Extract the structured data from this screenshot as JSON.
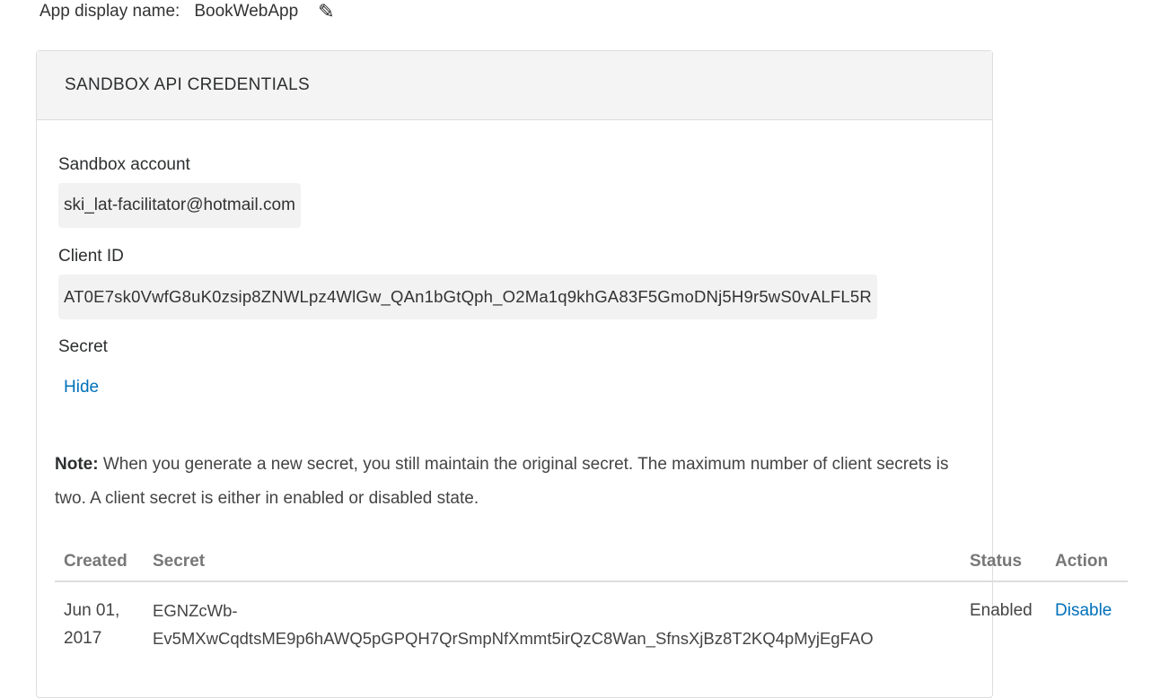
{
  "app": {
    "label": "App display name:",
    "name": "BookWebApp",
    "edit_icon": "pencil-icon"
  },
  "card": {
    "title": "SANDBOX API CREDENTIALS",
    "sandbox_account_label": "Sandbox account",
    "sandbox_account": "ski_lat-facilitator@hotmail.com",
    "client_id_label": "Client ID",
    "client_id": "AT0E7sk0VwfG8uK0zsip8ZNWLpz4WlGw_QAn1bGtQph_O2Ma1q9khGA83F5GmoDNj5H9r5wS0vALFL5R",
    "secret_label": "Secret",
    "hide_label": "Hide",
    "note_bold": "Note:",
    "note_text": " When you generate a new secret, you still maintain the original secret. The maximum number of client secrets is two. A client secret is either in enabled or disabled state."
  },
  "secrets_table": {
    "headers": [
      "Created",
      "Secret",
      "Status",
      "Action"
    ],
    "rows": [
      {
        "created_line1": "Jun 01,",
        "created_line2": "2017",
        "secret_line1": "EGNZcWb-",
        "secret_line2": "Ev5MXwCqdtsME9p6hAWQ5pGPQH7QrSmpNfXmmt5irQzC8Wan_SfnsXjBz8T2KQ4pMyjEgFAO",
        "status": "Enabled",
        "action": "Disable"
      }
    ]
  },
  "colors": {
    "link": "#0070ba",
    "header_bg": "#f4f4f4",
    "value_bg": "#f2f2f2"
  }
}
